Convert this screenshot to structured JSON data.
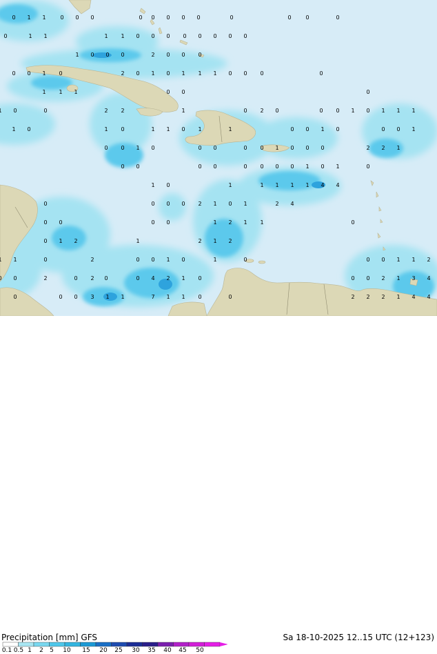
{
  "header": {
    "product": "Precipitation [mm]",
    "model": "GFS",
    "valid": "Sa 18-10-2025 12..15 UTC (12+123)"
  },
  "legend": {
    "ticks": [
      "0.1",
      "0.5",
      "1",
      "2",
      "5",
      "10",
      "15",
      "20",
      "25",
      "30",
      "35",
      "40",
      "45",
      "50"
    ],
    "colors": [
      "#ffffff",
      "#a8e6f2",
      "#79d8ef",
      "#4ec7ea",
      "#33b5e0",
      "#1c9ad6",
      "#1a6fc6",
      "#1e4cb0",
      "#1b2d96",
      "#2a1e8a",
      "#7a1fae",
      "#b220c9",
      "#d21fd8",
      "#e51fe6"
    ]
  },
  "palette": {
    "sea": "#d7ecf7",
    "land": "#dcd8b6",
    "rain_light": "#9fe2f0",
    "rain_medium": "#55c6ea",
    "rain_heavy": "#2d9fdb",
    "label_text": "#000000"
  },
  "grid_values": [
    [
      "0",
      "1",
      "1",
      "0",
      "0",
      "0",
      "0",
      "0",
      "0",
      "0",
      "0",
      "0",
      "0",
      "0",
      "0"
    ],
    [
      "0",
      "1",
      "1",
      "1",
      "1",
      "0",
      "0",
      "0",
      "0",
      "0",
      "0",
      "0",
      "0"
    ],
    [
      "1",
      "0",
      "0",
      "0",
      "2",
      "0",
      "0",
      "0"
    ],
    [
      "0",
      "0",
      "1",
      "0",
      "2",
      "0",
      "1",
      "0",
      "1",
      "1",
      "1",
      "0",
      "0",
      "0",
      "0"
    ],
    [
      "1",
      "1",
      "1",
      "0",
      "0",
      "0"
    ],
    [
      "1",
      "0",
      "0",
      "2",
      "2",
      "1",
      "0",
      "2",
      "0",
      "0",
      "0",
      "1",
      "0",
      "1",
      "1",
      "1"
    ],
    [
      "1",
      "0",
      "1",
      "0",
      "1",
      "1",
      "0",
      "1",
      "1",
      "0",
      "0",
      "1",
      "0",
      "0",
      "0",
      "1"
    ],
    [
      "0",
      "0",
      "1",
      "0",
      "0",
      "0",
      "0",
      "0",
      "1",
      "0",
      "0",
      "0",
      "2",
      "2",
      "1"
    ],
    [
      "0",
      "0",
      "0",
      "0",
      "0",
      "0",
      "0",
      "0",
      "1",
      "0",
      "1",
      "0"
    ],
    [
      "1",
      "0",
      "1",
      "1",
      "1",
      "1",
      "1",
      "4",
      "4"
    ],
    [
      "0",
      "0",
      "0",
      "0",
      "2",
      "1",
      "0",
      "1",
      "2",
      "4"
    ],
    [
      "0",
      "0",
      "0",
      "0",
      "1",
      "2",
      "1",
      "1",
      "0"
    ],
    [
      "0",
      "1",
      "2",
      "1",
      "2",
      "1",
      "2"
    ],
    [
      "1",
      "1",
      "0",
      "2",
      "0",
      "0",
      "1",
      "0",
      "1",
      "0",
      "0",
      "0",
      "1",
      "1",
      "2"
    ],
    [
      "0",
      "0",
      "2",
      "0",
      "2",
      "0",
      "0",
      "4",
      "2",
      "1",
      "0",
      "0",
      "0",
      "2",
      "1",
      "3",
      "4"
    ],
    [
      "0",
      "0",
      "0",
      "3",
      "1",
      "1",
      "7",
      "1",
      "1",
      "0",
      "0",
      "2",
      "2",
      "2",
      "1",
      "4",
      "4"
    ]
  ]
}
